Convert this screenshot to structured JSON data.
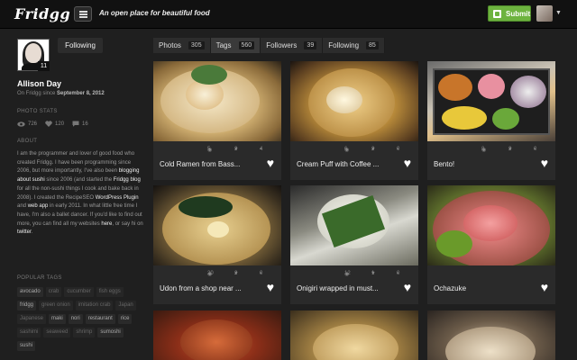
{
  "header": {
    "logo": "Fridgg",
    "tagline": "An open place for beautiful food",
    "submit_label": "Submit"
  },
  "profile": {
    "badge": "11",
    "following_label": "Following",
    "name": "Allison Day",
    "since_prefix": "On Fridgg since",
    "since_date": "September 8, 2012",
    "photo_stats_label": "PHOTO STATS",
    "stats": {
      "views": "726",
      "likes": "120",
      "comments": "16"
    },
    "about_label": "ABOUT",
    "about": {
      "p1": "I am the programmer and lover of good food who created Fridgg. I have been programming since 2006, but more importantly, I've also been ",
      "l1": "blogging about sushi",
      "p2": " since 2006 (and started the ",
      "l2": "Fridgg blog",
      "p3": " for all the non-sushi things I cook and bake back in 2008). I created the RecipeSEO ",
      "l3": "WordPress Plugin",
      "p4": " and ",
      "l4": "web app",
      "p5": " in early 2011. In what little free time I have, I'm also a ballet dancer. If you'd like to find out more, you can find all my websites ",
      "l5": "here",
      "p6": ", or say hi on ",
      "l6": "twitter",
      "p7": "."
    },
    "popular_tags_label": "POPULAR TAGS",
    "tags": [
      {
        "t": "avocado",
        "d": false
      },
      {
        "t": "crab",
        "d": true
      },
      {
        "t": "cucumber",
        "d": true
      },
      {
        "t": "fish eggs",
        "d": true
      },
      {
        "t": "fridgg",
        "d": false
      },
      {
        "t": "green onion",
        "d": true
      },
      {
        "t": "imitation crab",
        "d": true
      },
      {
        "t": "Japan",
        "d": true
      },
      {
        "t": "Japanese",
        "d": true
      },
      {
        "t": "maki",
        "d": false
      },
      {
        "t": "nori",
        "d": false
      },
      {
        "t": "restaurant",
        "d": false
      },
      {
        "t": "rice",
        "d": false
      },
      {
        "t": "sashimi",
        "d": true
      },
      {
        "t": "seaweed",
        "d": true
      },
      {
        "t": "shrimp",
        "d": true
      },
      {
        "t": "sumoshi",
        "d": false
      },
      {
        "t": "sushi",
        "d": false
      }
    ]
  },
  "tabs": [
    {
      "label": "Photos",
      "count": "305"
    },
    {
      "label": "Tags",
      "count": "560"
    },
    {
      "label": "Followers",
      "count": "39"
    },
    {
      "label": "Following",
      "count": "85"
    }
  ],
  "cards": [
    {
      "caption": "Cold Ramen from Bass...",
      "views": "5",
      "likes": "2",
      "comments": "4"
    },
    {
      "caption": "Cream Puff with Coffee ...",
      "views": "6",
      "likes": "2",
      "comments": "0"
    },
    {
      "caption": "Bento!",
      "views": "8",
      "likes": "2",
      "comments": "0"
    },
    {
      "caption": "Udon from a shop near ...",
      "views": "20",
      "likes": "2",
      "comments": "0"
    },
    {
      "caption": "Onigiri wrapped in must...",
      "views": "12",
      "likes": "1",
      "comments": "0"
    },
    {
      "caption": "Ochazuke",
      "views": "",
      "likes": "",
      "comments": ""
    }
  ],
  "colors": {
    "accent_green": "#6db33f",
    "background": "#1f1f1f",
    "card": "#2a2a2a"
  }
}
